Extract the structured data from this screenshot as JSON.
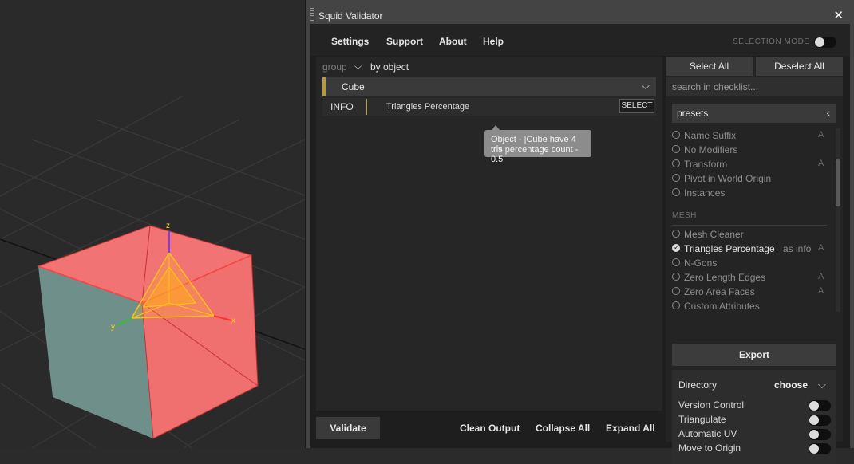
{
  "window": {
    "title": "Squid Validator",
    "close_glyph": "✕"
  },
  "menu": {
    "items": [
      "Settings",
      "Support",
      "About",
      "Help"
    ],
    "selection_mode_label": "SELECTION MODE"
  },
  "results": {
    "group_label": "group",
    "group_value": "by object",
    "object_name": "Cube",
    "entry": {
      "level": "INFO",
      "check": "Triangles Percentage",
      "select_label": "SELECT"
    },
    "tooltip_lines": [
      "Object - |Cube have 4 tris.",
      "tris percentage count - 0.5"
    ]
  },
  "bottom": {
    "validate_label": "Validate",
    "clean_label": "Clean Output",
    "collapse_label": "Collapse All",
    "expand_label": "Expand All"
  },
  "checklist": {
    "select_all_label": "Select All",
    "deselect_all_label": "Deselect All",
    "search_placeholder": "search in checklist...",
    "presets_label": "presets",
    "items_general": [
      {
        "label": "Name Suffix",
        "checked": false,
        "a": "A"
      },
      {
        "label": "No Modifiers",
        "checked": false,
        "a": ""
      },
      {
        "label": "Transform",
        "checked": false,
        "a": "A"
      },
      {
        "label": "Pivot in World Origin",
        "checked": false,
        "a": ""
      },
      {
        "label": "Instances",
        "checked": false,
        "a": ""
      }
    ],
    "mesh_header": "MESH",
    "items_mesh": [
      {
        "label": "Mesh Cleaner",
        "checked": false,
        "a": ""
      },
      {
        "label": "Triangles Percentage",
        "checked": true,
        "extra": "as info",
        "a": "A"
      },
      {
        "label": "N-Gons",
        "checked": false,
        "a": ""
      },
      {
        "label": "Zero Length Edges",
        "checked": false,
        "a": "A"
      },
      {
        "label": "Zero Area Faces",
        "checked": false,
        "a": "A"
      },
      {
        "label": "Custom Attributes",
        "checked": false,
        "a": ""
      }
    ]
  },
  "export": {
    "label": "Export",
    "directory_label": "Directory",
    "choose_label": "choose",
    "options": [
      "Version Control",
      "Triangulate",
      "Automatic UV",
      "Move to Origin"
    ]
  },
  "viewport": {
    "gizmo_axes": {
      "x": "x",
      "y": "y",
      "z": "z"
    },
    "colors": {
      "face_selected": "#f07070",
      "face_side": "#6f8f8a",
      "gizmo": "#ffc21a"
    }
  }
}
